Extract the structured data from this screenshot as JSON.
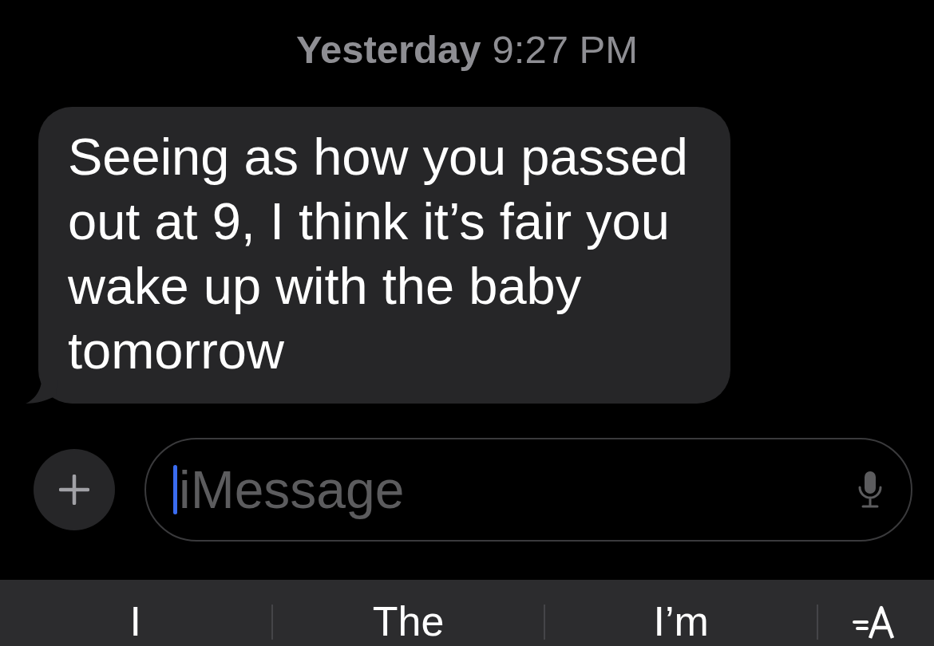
{
  "timestamp": {
    "day": "Yesterday",
    "time": "9:27 PM"
  },
  "messages": [
    {
      "kind": "received",
      "text": "Seeing as how you passed out at 9, I think it’s fair you wake up with the baby tomorrow"
    }
  ],
  "compose": {
    "placeholder": "iMessage"
  },
  "suggestions": [
    {
      "kind": "word",
      "text": "I"
    },
    {
      "kind": "word",
      "text": "The"
    },
    {
      "kind": "word",
      "text": "I’m"
    },
    {
      "kind": "format"
    }
  ]
}
